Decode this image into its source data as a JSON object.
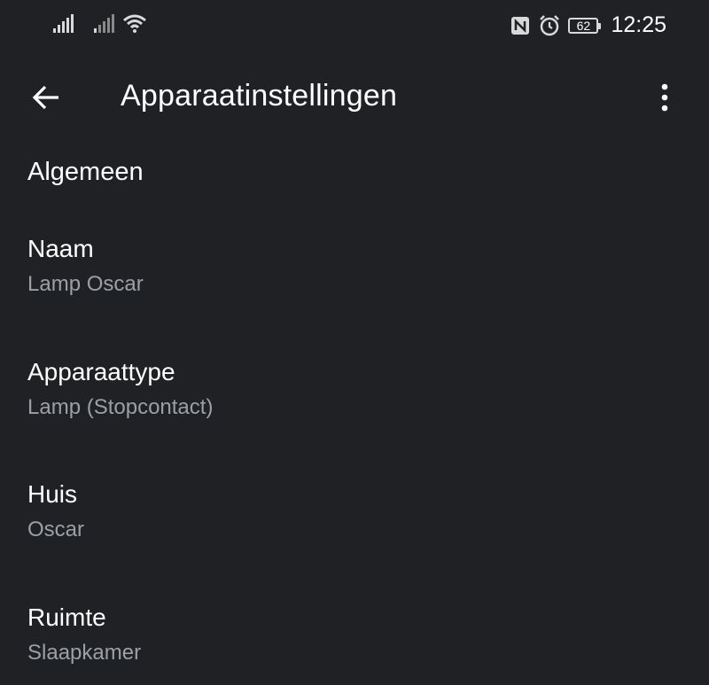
{
  "status_bar": {
    "time": "12:25",
    "battery_level": "62",
    "icons": [
      "signal-icon",
      "signal-icon",
      "wifi-icon",
      "nfc-icon",
      "alarm-icon",
      "battery-icon"
    ]
  },
  "app_bar": {
    "title": "Apparaatinstellingen",
    "back_icon": "arrow-back-icon",
    "menu_icon": "more-vert-icon"
  },
  "content": {
    "section_title": "Algemeen",
    "settings": [
      {
        "label": "Naam",
        "value": "Lamp Oscar"
      },
      {
        "label": "Apparaattype",
        "value": "Lamp (Stopcontact)"
      },
      {
        "label": "Huis",
        "value": "Oscar"
      },
      {
        "label": "Ruimte",
        "value": "Slaapkamer"
      }
    ]
  },
  "colors": {
    "background": "#202124",
    "primary_text": "#ffffff",
    "secondary_text": "#9aa0a6"
  }
}
